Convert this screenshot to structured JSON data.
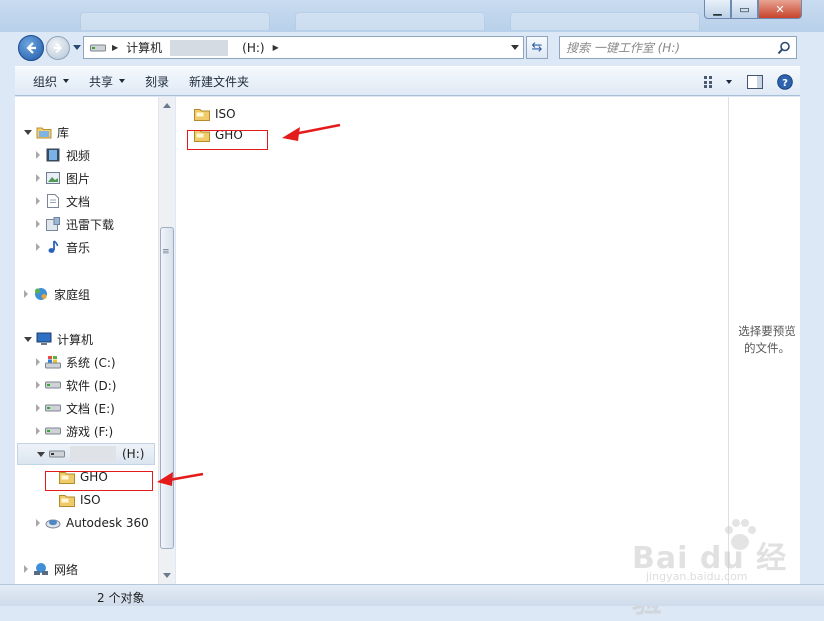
{
  "window": {
    "controls": [
      "minimize",
      "maximize",
      "close"
    ]
  },
  "address_bar": {
    "segments": [
      "计算机",
      "(H:)"
    ],
    "search_placeholder": "搜索 一键工作室 (H:)"
  },
  "toolbar": {
    "organize": "组织",
    "share": "共享",
    "burn": "刻录",
    "new_folder": "新建文件夹"
  },
  "nav_tree": {
    "library": "库",
    "videos": "视频",
    "pictures": "图片",
    "documents": "文档",
    "thunder": "迅雷下载",
    "music": "音乐",
    "homegroup": "家庭组",
    "computer": "计算机",
    "drive_c": "系统 (C:)",
    "drive_d": "软件 (D:)",
    "drive_e": "文档 (E:)",
    "drive_f": "游戏 (F:)",
    "drive_h": "(H:)",
    "sub_gho": "GHO",
    "sub_iso": "ISO",
    "autodesk": "Autodesk 360",
    "network": "网络"
  },
  "files": [
    {
      "name": "ISO"
    },
    {
      "name": "GHO"
    }
  ],
  "preview": {
    "text_line1": "选择要预览",
    "text_line2": "的文件。"
  },
  "status": {
    "count": "2 个对象"
  },
  "watermark": {
    "brand": "Bai du 经验",
    "url": "jingyan.baidu.com"
  },
  "colors": {
    "highlight_red": "#e51a1a",
    "folder": "#e8c46a"
  }
}
